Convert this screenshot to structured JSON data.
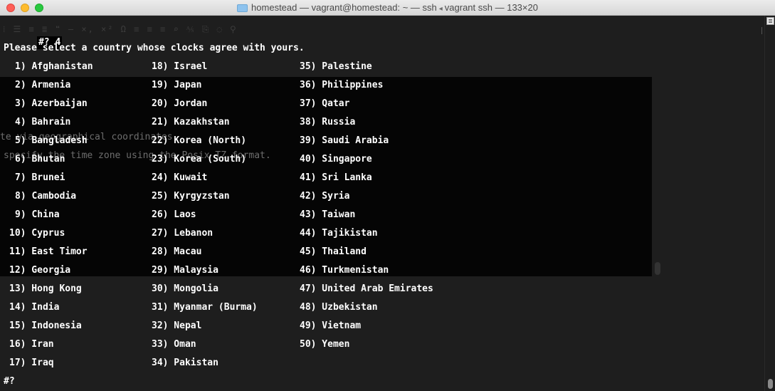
{
  "window": {
    "title_folder": "homestead",
    "title_main": "homestead — vagrant@homestead: ~ — ssh",
    "title_sub": "vagrant ssh — 133×20"
  },
  "terminal": {
    "top_prompt": "#? 4",
    "heading": "Please select a country whose clocks agree with yours.",
    "bottom_prompt": "#?",
    "columns": [
      [
        "1) Afghanistan",
        "2) Armenia",
        "3) Azerbaijan",
        "4) Bahrain",
        "5) Bangladesh",
        "6) Bhutan",
        "7) Brunei",
        "8) Cambodia",
        "9) China",
        "10) Cyprus",
        "11) East Timor",
        "12) Georgia",
        "13) Hong Kong",
        "14) India",
        "15) Indonesia",
        "16) Iran",
        "17) Iraq"
      ],
      [
        "18) Israel",
        "19) Japan",
        "20) Jordan",
        "21) Kazakhstan",
        "22) Korea (North)",
        "23) Korea (South)",
        "24) Kuwait",
        "25) Kyrgyzstan",
        "26) Laos",
        "27) Lebanon",
        "28) Macau",
        "29) Malaysia",
        "30) Mongolia",
        "31) Myanmar (Burma)",
        "32) Nepal",
        "33) Oman",
        "34) Pakistan"
      ],
      [
        "35) Palestine",
        "36) Philippines",
        "37) Qatar",
        "38) Russia",
        "39) Saudi Arabia",
        "40) Singapore",
        "41) Sri Lanka",
        "42) Syria",
        "43) Taiwan",
        "44) Tajikistan",
        "45) Thailand",
        "46) Turkmenistan",
        "47) United Arab Emirates",
        "48) Uzbekistan",
        "49) Vietnam",
        "50) Yemen"
      ]
    ]
  },
  "ghost": {
    "toolbar": "⁞ ☰ ≡ ≣ ❝  — ×, ×² Ω  ≡ ≡ ≡  ⌕ ⅍  ⎘ ◌ ⚲",
    "line1": "te via geographical coordinates",
    "line2": "specify the time zone using the Posix TZ format."
  }
}
